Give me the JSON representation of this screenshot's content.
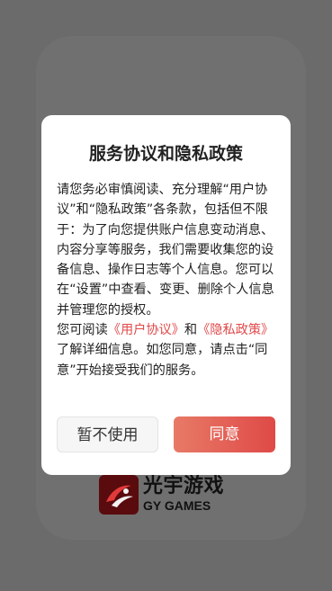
{
  "brand": {
    "name_cn": "光宇游戏",
    "name_en": "GY GAMES"
  },
  "dialog": {
    "title": "服务协议和隐私政策",
    "paragraph1": "请您务必审慎阅读、充分理解“用户协议”和“隐私政策”各条款，包括但不限于：为了向您提供账户信息变动消息、内容分享等服务，我们需要收集您的设备信息、操作日志等个人信息。您可以在“设置”中查看、变更、删除个人信息并管理您的授权。",
    "paragraph2_prefix": "您可阅读",
    "user_agreement_link": "《用户协议》",
    "and_text": "和",
    "privacy_policy_link": "《隐私政策》",
    "paragraph2_suffix": "了解详细信息。如您同意，请点击“同意”开始接受我们的服务。",
    "decline_label": "暂不使用",
    "agree_label": "同意"
  },
  "colors": {
    "overlay": "#6b6b6b",
    "link": "#e0494a",
    "agree_gradient_start": "#e87a67",
    "agree_gradient_end": "#df4a47"
  }
}
